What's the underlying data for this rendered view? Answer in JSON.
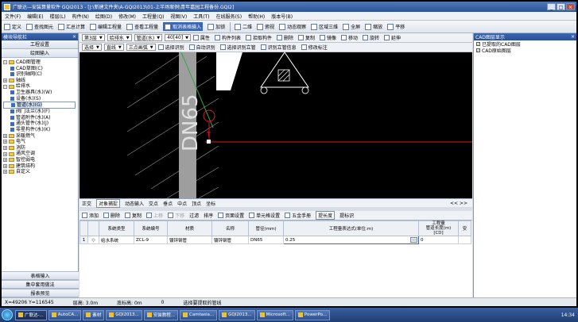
{
  "window": {
    "title": "广联达—安装算量软件 GQI2013 - [J:\\新建文件夹\\A-GQI2013\\01-上半场案例\\青年嘉园工程备份.GQI2]"
  },
  "menu": [
    "文件(F)",
    "编辑(E)",
    "楼层(L)",
    "构件(N)",
    "绘图(D)",
    "修改(M)",
    "工程量(Q)",
    "视图(V)",
    "工具(T)",
    "在线服务(S)",
    "帮助(H)",
    "版本号(B)"
  ],
  "toolbar": {
    "items": [
      "定义",
      "查找图元",
      "汇总计算",
      "编辑工程量",
      "查看工程量",
      "取消表格输入",
      "加锁"
    ],
    "highlighted": "取消表格输入",
    "view_items": [
      "二维",
      "俯视",
      "动态观察",
      "区域三维",
      "全屏",
      "缩放",
      "平移"
    ]
  },
  "nav": {
    "header": "模块导航栏",
    "buttons": [
      "工程设置",
      "绘图输入"
    ],
    "tree": [
      {
        "label": "CAD图管理",
        "level": 0,
        "type": "folder",
        "exp": "-"
      },
      {
        "label": "CAD草图(C)",
        "level": 1,
        "type": "leaf"
      },
      {
        "label": "识别轴网(C)",
        "level": 1,
        "type": "leaf"
      },
      {
        "label": "轴线",
        "level": 0,
        "type": "folder",
        "exp": "+"
      },
      {
        "label": "给排水",
        "level": 0,
        "type": "folder",
        "exp": "-"
      },
      {
        "label": "卫生器具(水)(W)",
        "level": 1,
        "type": "leaf"
      },
      {
        "label": "设备(水)(S)",
        "level": 1,
        "type": "leaf"
      },
      {
        "label": "管道(水)(G)",
        "level": 1,
        "type": "leaf",
        "selected": true
      },
      {
        "label": "阀门法兰(水)(F)",
        "level": 1,
        "type": "leaf"
      },
      {
        "label": "管道附件(水)(A)",
        "level": 1,
        "type": "leaf"
      },
      {
        "label": "通头管件(水)(J)",
        "level": 1,
        "type": "leaf"
      },
      {
        "label": "零星构件(水)(K)",
        "level": 1,
        "type": "leaf"
      },
      {
        "label": "采暖燃气",
        "level": 0,
        "type": "folder",
        "exp": "+"
      },
      {
        "label": "电气",
        "level": 0,
        "type": "folder",
        "exp": "+"
      },
      {
        "label": "消防",
        "level": 0,
        "type": "folder",
        "exp": "+"
      },
      {
        "label": "通风空调",
        "level": 0,
        "type": "folder",
        "exp": "+"
      },
      {
        "label": "智控弱电",
        "level": 0,
        "type": "folder",
        "exp": "+"
      },
      {
        "label": "建筑结构",
        "level": 0,
        "type": "folder",
        "exp": "+"
      },
      {
        "label": "自定义",
        "level": 0,
        "type": "folder",
        "exp": "+"
      }
    ],
    "bottom_buttons": [
      "表格输入",
      "集中套用做法",
      "报表预览"
    ]
  },
  "layer_bar": {
    "floor": "第3层",
    "category": "给排水",
    "element": "管道(水)",
    "spec": "40[40]",
    "items": [
      "属性",
      "构件列表",
      "拾取构件",
      "删除",
      "复制",
      "镜像",
      "移动",
      "旋转",
      "延伸"
    ]
  },
  "draw_bar": {
    "select": "选择",
    "line": "直线",
    "arc": "三点画弧",
    "items": [
      "选择识别",
      "自动识别",
      "选择识别立管",
      "识别立管信息",
      "修改标注"
    ]
  },
  "canvas": {
    "label": "DN65",
    "symbol_label": "T"
  },
  "right_panel": {
    "header": "CAD图层显示",
    "rows": [
      {
        "label": "已提取的CAD图层",
        "checked": true
      },
      {
        "label": "CAD原始图层",
        "checked": true
      }
    ]
  },
  "snap_bar": {
    "items": [
      "正交",
      "对象捕捉",
      "动态输入",
      "交点",
      "垂点",
      "中点",
      "顶点",
      "坐标"
    ],
    "active": "对象捕捉",
    "nav": "<< >>"
  },
  "table_toolbar": {
    "items": [
      "添加",
      "删除",
      "复制",
      "上移",
      "下移",
      "过滤",
      "排序",
      "页面设置",
      "单元格设置",
      "五金手册",
      "提长度",
      "提标识"
    ],
    "disabled": [
      "上移",
      "下移"
    ],
    "active": "提长度"
  },
  "table": {
    "headers": [
      "",
      "",
      "系统类型",
      "系统编号",
      "材质",
      "名称",
      "管径(mm)",
      "工程量表达式(单位:m)",
      "工程量",
      "安"
    ],
    "subheader": "管道长度(m)\n[CD]",
    "rows": [
      {
        "no": "1",
        "mark": "◇",
        "system_type": "给水系统",
        "system_no": "ZCL-9",
        "material": "镀锌钢管",
        "name": "镀锌钢管",
        "diameter": "DN65",
        "expr": "0.25",
        "qty": "0"
      }
    ]
  },
  "status": {
    "coords": "X=49206 Y=116545",
    "floor_height": "层高: 3.0m",
    "floor_elev": "底标高: 0m",
    "zero": "0",
    "hint": "选择要提取的管线"
  },
  "taskbar": {
    "items": [
      "广联达-...",
      "AutoCA...",
      "素材",
      "GQI2013...",
      "安装教程...",
      "Camtasia...",
      "GQI2013...",
      "Microsoft...",
      "PowerPo..."
    ],
    "active": "广联达-...",
    "clock": "14:34"
  },
  "colors": {
    "titlebar": "#2d5597",
    "accent": "#3a66b4",
    "canvas": "#000000"
  }
}
